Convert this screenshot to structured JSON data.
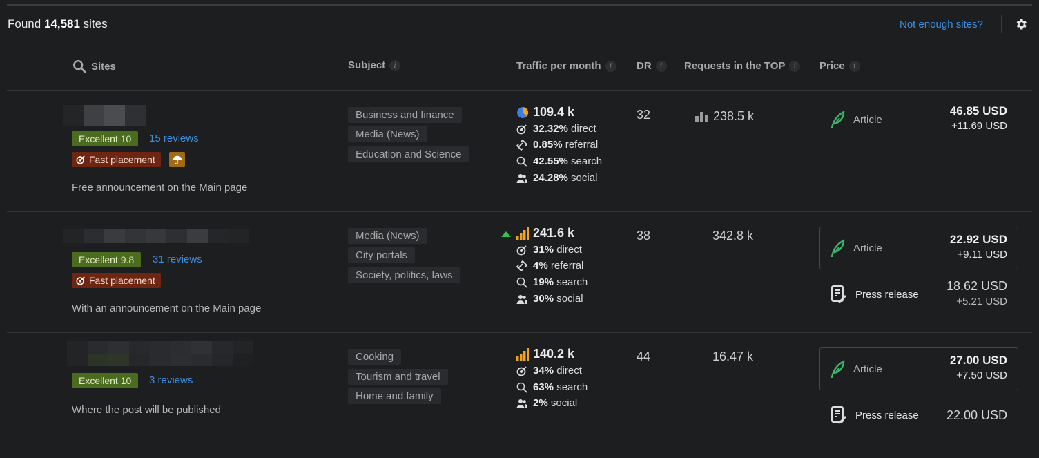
{
  "header": {
    "found_prefix": "Found",
    "found_count": "14,581",
    "found_suffix": "sites",
    "not_enough_link": "Not enough sites?",
    "settings_icon": "gear-icon"
  },
  "columns": {
    "sites": "Sites",
    "subject": "Subject",
    "traffic": "Traffic per month",
    "dr": "DR",
    "requests": "Requests in the TOP",
    "price": "Price",
    "info_glyph": "i"
  },
  "rows": [
    {
      "rating": "Excellent 10",
      "reviews": "15 reviews",
      "fast_placement": "Fast placement",
      "note": "Free announcement on the Main page",
      "subjects": [
        "Business and finance",
        "Media (News)",
        "Education and Science"
      ],
      "traffic_total": "109.4 k",
      "traffic": [
        {
          "pct": "32.32%",
          "label": "direct"
        },
        {
          "pct": "0.85%",
          "label": "referral"
        },
        {
          "pct": "42.55%",
          "label": "search"
        },
        {
          "pct": "24.28%",
          "label": "social"
        }
      ],
      "dr": "32",
      "requests": "238.5 k",
      "offers": [
        {
          "type": "Article",
          "price": "46.85 USD",
          "extra": "+11.69 USD"
        }
      ]
    },
    {
      "rating": "Excellent 9.8",
      "reviews": "31 reviews",
      "fast_placement": "Fast placement",
      "note": "With an announcement on the Main page",
      "subjects": [
        "Media (News)",
        "City portals",
        "Society, politics, laws"
      ],
      "traffic_total": "241.6 k",
      "traffic": [
        {
          "pct": "31%",
          "label": "direct"
        },
        {
          "pct": "4%",
          "label": "referral"
        },
        {
          "pct": "19%",
          "label": "search"
        },
        {
          "pct": "30%",
          "label": "social"
        }
      ],
      "dr": "38",
      "requests": "342.8 k",
      "offers": [
        {
          "type": "Article",
          "price": "22.92 USD",
          "extra": "+9.11 USD"
        },
        {
          "type": "Press release",
          "price": "18.62 USD",
          "extra": "+5.21 USD"
        }
      ]
    },
    {
      "rating": "Excellent 10",
      "reviews": "3 reviews",
      "note": "Where the post will be published",
      "subjects": [
        "Cooking",
        "Tourism and travel",
        "Home and family"
      ],
      "traffic_total": "140.2 k",
      "traffic": [
        {
          "pct": "34%",
          "label": "direct"
        },
        {
          "pct": "63%",
          "label": "search"
        },
        {
          "pct": "2%",
          "label": "social"
        }
      ],
      "dr": "44",
      "requests": "16.47 k",
      "offers": [
        {
          "type": "Article",
          "price": "27.00 USD",
          "extra": "+7.50 USD"
        },
        {
          "type": "Press release",
          "price": "22.00 USD"
        }
      ]
    }
  ],
  "colors": {
    "background": "#1d1e20",
    "link": "#3d8fe0",
    "rating_bg": "#4b6b1e",
    "fast_bg": "#6e2612",
    "umbrella_bg": "#a06a16",
    "feather": "#3db86a",
    "trend_up": "#33c24d",
    "bars": "#f0a31b"
  }
}
